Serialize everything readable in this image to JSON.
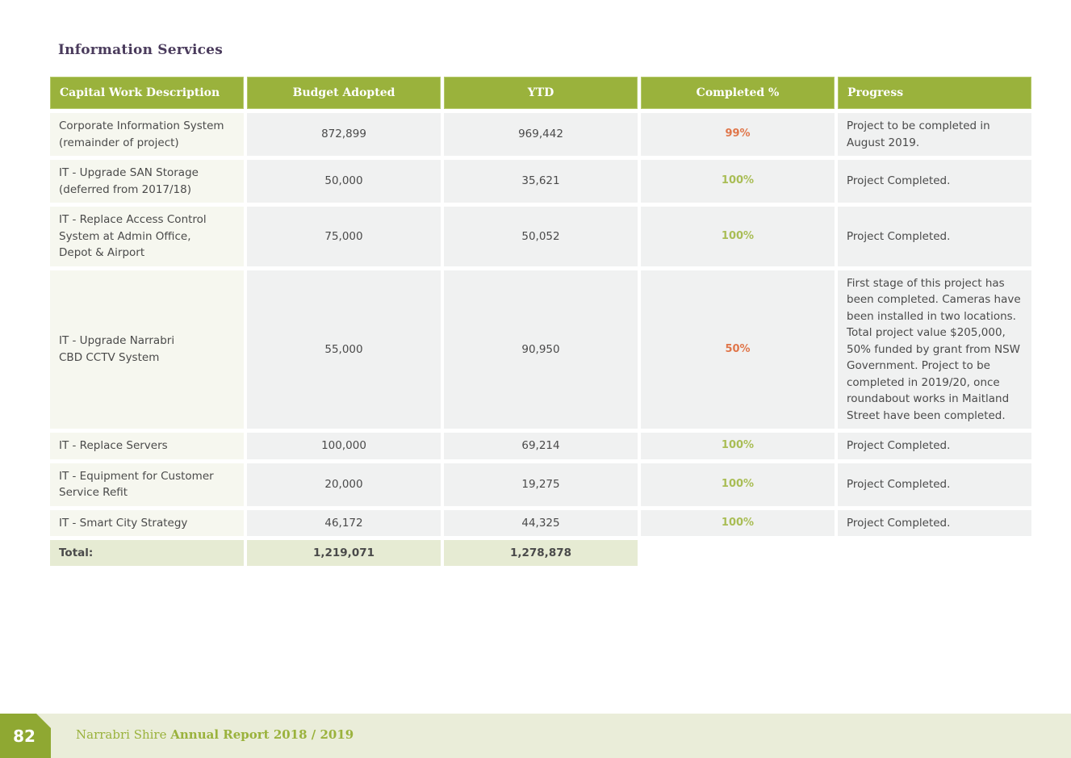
{
  "section": {
    "title": "Information Services"
  },
  "table": {
    "headers": [
      "Capital Work Description",
      "Budget Adopted",
      "YTD",
      "Completed %",
      "Progress"
    ],
    "rows": [
      {
        "description_lines": [
          "Corporate Information System",
          "(remainder of project)"
        ],
        "budget": "872,899",
        "ytd": "969,442",
        "completed": "99%",
        "status": "incomplete",
        "progress": "Project to be completed in August 2019."
      },
      {
        "description_lines": [
          "IT - Upgrade SAN Storage",
          "(deferred from 2017/18)"
        ],
        "budget": "50,000",
        "ytd": "35,621",
        "completed": "100%",
        "status": "complete",
        "progress": "Project Completed."
      },
      {
        "description_lines": [
          "IT - Replace Access Control",
          "System at Admin Office,",
          "Depot & Airport"
        ],
        "budget": "75,000",
        "ytd": "50,052",
        "completed": "100%",
        "status": "complete",
        "progress": "Project Completed."
      },
      {
        "description_lines": [
          "IT - Upgrade Narrabri",
          "CBD CCTV System"
        ],
        "budget": "55,000",
        "ytd": "90,950",
        "completed": "50%",
        "status": "incomplete",
        "progress": "First stage of this project has been completed. Cameras have been installed in two locations. Total project value $205,000, 50% funded by grant from NSW Government. Project to be completed in 2019/20, once roundabout works in Maitland Street have been completed."
      },
      {
        "description_lines": [
          "IT - Replace Servers"
        ],
        "budget": "100,000",
        "ytd": "69,214",
        "completed": "100%",
        "status": "complete",
        "progress": "Project Completed."
      },
      {
        "description_lines": [
          "IT - Equipment for Customer",
          "Service Refit"
        ],
        "budget": "20,000",
        "ytd": "19,275",
        "completed": "100%",
        "status": "complete",
        "progress": "Project Completed."
      },
      {
        "description_lines": [
          "IT - Smart City Strategy"
        ],
        "budget": "46,172",
        "ytd": "44,325",
        "completed": "100%",
        "status": "complete",
        "progress": "Project Completed."
      }
    ],
    "total": {
      "label": "Total:",
      "budget": "1,219,071",
      "ytd": "1,278,878"
    }
  },
  "footer": {
    "page_number": "82",
    "org": "Narrabri Shire",
    "report": "Annual Report 2018 / 2019"
  },
  "colors": {
    "header_green": "#9ab23c",
    "complete_green": "#a9bd55",
    "incomplete_orange": "#e0764a",
    "title_purple": "#4a3b5c"
  }
}
